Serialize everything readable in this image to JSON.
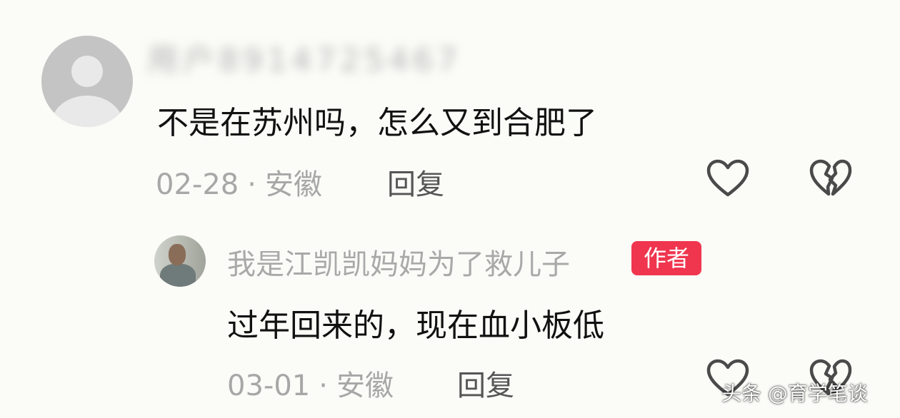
{
  "comment1": {
    "username_blurred": "用户8914725467",
    "text": "不是在苏州吗，怎么又到合肥了",
    "date": "02-28",
    "separator": "·",
    "location": "安徽",
    "reply_label": "回复",
    "avatar_icon": "default-avatar-icon",
    "like_icon": "heart-icon",
    "dislike_icon": "broken-heart-icon"
  },
  "comment2": {
    "username": "我是江凯凯妈妈为了救儿子",
    "badge": "作者",
    "text": "过年回来的，现在血小板低",
    "date": "03-01",
    "separator": "·",
    "location": "安徽",
    "reply_label": "回复",
    "avatar_icon": "user-photo-avatar",
    "like_icon": "heart-icon",
    "dislike_icon": "broken-heart-icon"
  },
  "watermark": "头条 @育学笔谈",
  "colors": {
    "badge": "#f0364f",
    "meta_text": "#a7a7a7",
    "main_text": "#111111",
    "icon_stroke": "#4a4a4a"
  }
}
